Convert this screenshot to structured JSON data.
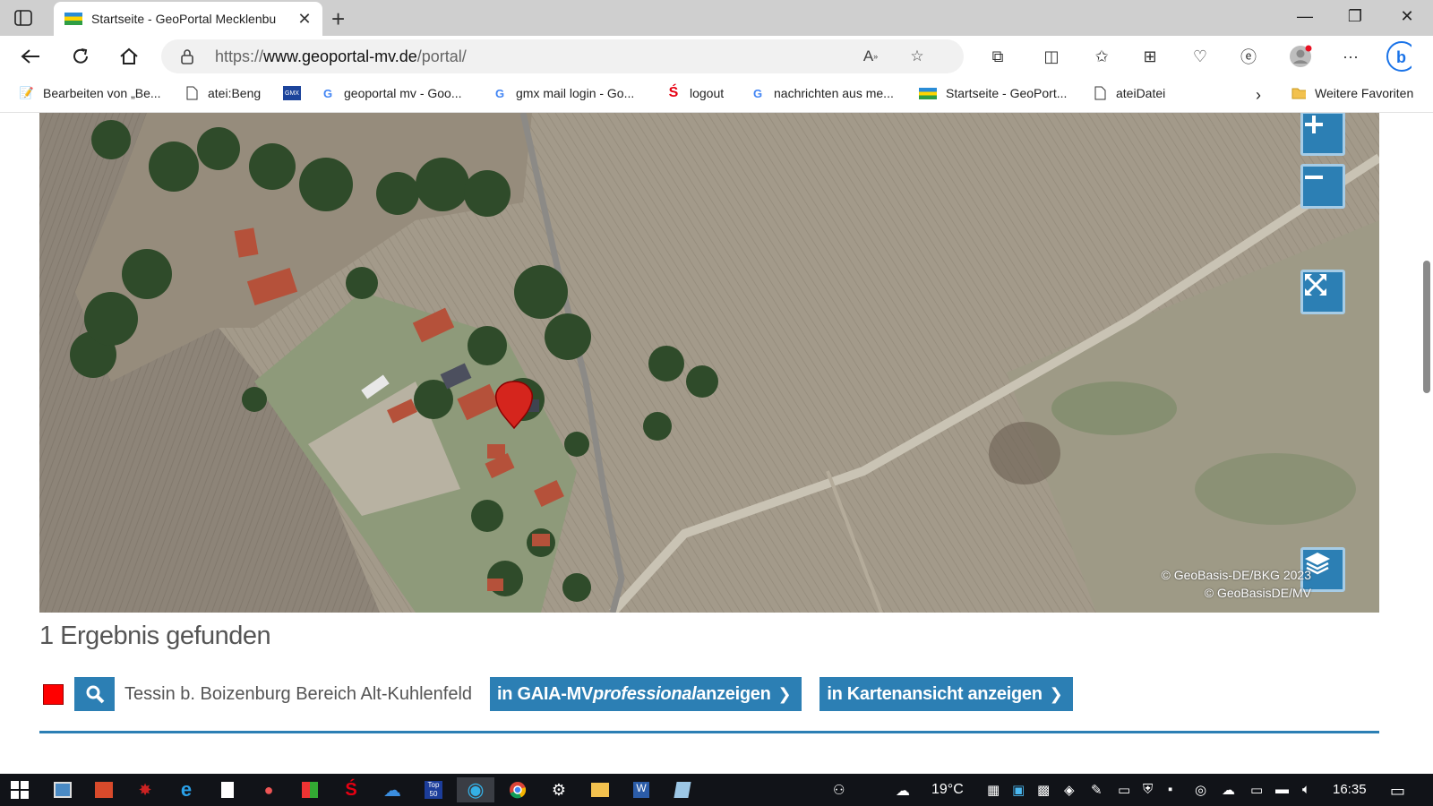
{
  "browser": {
    "tab_title": "Startseite - GeoPortal Mecklenbu",
    "url_prefix": "https://",
    "url_domain": "www.geoportal-mv.de",
    "url_path": "/portal/"
  },
  "bookmarks": [
    {
      "label": "Bearbeiten von „Be...",
      "icon": "edit-page-icon"
    },
    {
      "label": "atei:Beng",
      "icon": "page-icon"
    },
    {
      "label": "",
      "icon": "gmx-icon"
    },
    {
      "label": "geoportal mv - Goo...",
      "icon": "google-icon"
    },
    {
      "label": "gmx mail login - Go...",
      "icon": "google-icon"
    },
    {
      "label": "logout",
      "icon": "sparkasse-icon"
    },
    {
      "label": "nachrichten aus me...",
      "icon": "google-icon"
    },
    {
      "label": "Startseite - GeoPort...",
      "icon": "geoportal-icon"
    },
    {
      "label": "ateiDatei",
      "icon": "page-icon"
    }
  ],
  "bookmarks_more": "Weitere Favoriten",
  "map": {
    "attribution_1": "© GeoBasis-DE/BKG 2023",
    "attribution_2": "© GeoBasisDE/MV"
  },
  "results": {
    "heading": "1 Ergebnis gefunden",
    "item_name": "Tessin b. Boizenburg Bereich Alt-Kuhlenfeld",
    "btn_gaia_prefix": "in GAIA-MV",
    "btn_gaia_italic": "professional",
    "btn_gaia_suffix": " anzeigen",
    "btn_map": "in Kartenansicht anzeigen",
    "swatch_color": "#ff0000"
  },
  "taskbar": {
    "temperature": "19°C",
    "time": "16:35"
  },
  "colors": {
    "accent": "#2c7fb4"
  }
}
